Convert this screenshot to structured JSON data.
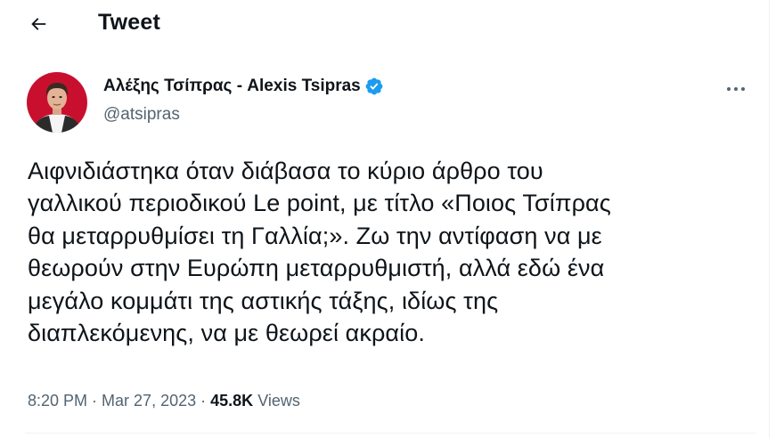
{
  "header": {
    "title": "Tweet",
    "back_icon": "arrow-left-icon"
  },
  "author": {
    "display_name": "Αλέξης Τσίπρας - Alexis Tsipras",
    "handle": "@atsipras",
    "verified": true,
    "verified_color": "#1d9bf0",
    "avatar_bg": "#c8102e"
  },
  "tweet": {
    "lines": [
      "Αιφνιδιάστηκα όταν διάβασα το κύριο άρθρο του",
      "γαλλικού περιοδικού Le point, με τίτλο «Ποιος Τσίπρας",
      "θα μεταρρυθμίσει τη Γαλλία;». Ζω την αντίφαση να με",
      "θεωρούν στην Ευρώπη μεταρρυθμιστή, αλλά εδώ ένα",
      "μεγάλο κομμάτι της αστικής τάξης, ιδίως της",
      "διαπλεκόμενης, να με θεωρεί ακραίο."
    ]
  },
  "meta": {
    "time": "8:20 PM",
    "separator": " · ",
    "date": "Mar 27, 2023",
    "views_count": "45.8K",
    "views_label": "Views"
  },
  "colors": {
    "text_primary": "#0f1419",
    "text_secondary": "#536471",
    "border": "#eff3f4"
  }
}
